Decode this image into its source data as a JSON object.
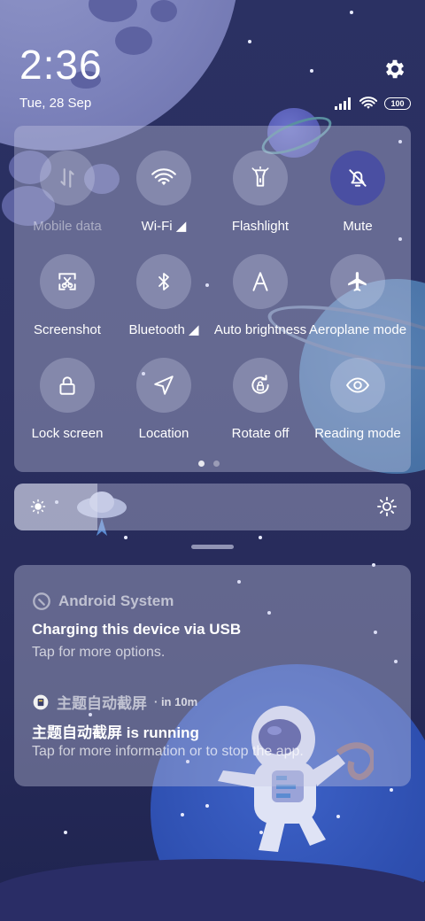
{
  "status": {
    "time": "2:36",
    "date": "Tue, 28 Sep",
    "battery": "100",
    "signal_icon": "signal-bars-icon",
    "wifi_icon": "wifi-icon",
    "settings_icon": "gear-icon"
  },
  "quick_settings": {
    "tiles": [
      {
        "label": "Mobile data",
        "icon": "mobile-data-icon",
        "state": "disabled"
      },
      {
        "label": "Wi-Fi",
        "icon": "wifi-icon",
        "state": "off",
        "has_menu": true
      },
      {
        "label": "Flashlight",
        "icon": "flashlight-icon",
        "state": "off"
      },
      {
        "label": "Mute",
        "icon": "bell-muted-icon",
        "state": "on"
      },
      {
        "label": "Screenshot",
        "icon": "screenshot-icon",
        "state": "off"
      },
      {
        "label": "Bluetooth",
        "icon": "bluetooth-icon",
        "state": "off",
        "has_menu": true
      },
      {
        "label": "Auto brightness",
        "icon": "auto-brightness-icon",
        "state": "off"
      },
      {
        "label": "Aeroplane mode",
        "icon": "airplane-icon",
        "state": "off"
      },
      {
        "label": "Lock screen",
        "icon": "lock-icon",
        "state": "off"
      },
      {
        "label": "Location",
        "icon": "location-arrow-icon",
        "state": "off"
      },
      {
        "label": "Rotate off",
        "icon": "rotate-lock-icon",
        "state": "off"
      },
      {
        "label": "Reading mode",
        "icon": "eye-icon",
        "state": "off"
      }
    ],
    "page_indicator": {
      "pages": 2,
      "current": 1
    }
  },
  "brightness": {
    "level": 0.21
  },
  "notifications": [
    {
      "app": "Android System",
      "title": "Charging this device via USB",
      "body": "Tap for more options.",
      "when": ""
    },
    {
      "app": "主题自动截屏",
      "when": "· in 10m",
      "title": "主题自动截屏 is running",
      "body": "Tap for more information or to stop the app."
    }
  ],
  "colors": {
    "background": "#2a2f60",
    "active_tile": "#4a4fa2",
    "panel": "rgba(196,200,226,0.38)"
  }
}
